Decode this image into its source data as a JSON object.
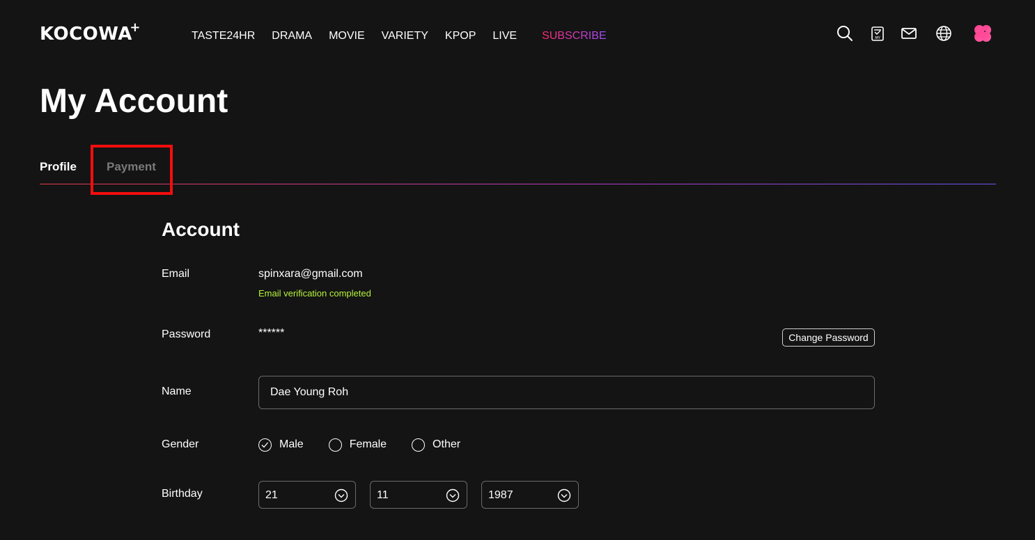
{
  "header": {
    "logo": "KOCOWA",
    "logo_plus": "+",
    "nav": [
      "TASTE24HR",
      "DRAMA",
      "MOVIE",
      "VARIETY",
      "KPOP",
      "LIVE"
    ],
    "subscribe": "SUBSCRIBE",
    "icons": [
      "search-icon",
      "my-list-icon",
      "mail-icon",
      "globe-icon",
      "profile-avatar-icon"
    ],
    "my_list_icon_text": "MY"
  },
  "page": {
    "title": "My Account"
  },
  "tabs": [
    {
      "label": "Profile",
      "active": true
    },
    {
      "label": "Payment",
      "active": false
    }
  ],
  "account": {
    "section_title": "Account",
    "email_label": "Email",
    "email_value": "spinxara@gmail.com",
    "email_note": "Email verification completed",
    "password_label": "Password",
    "password_value": "******",
    "change_password": "Change Password",
    "name_label": "Name",
    "name_value": "Dae Young Roh",
    "gender_label": "Gender",
    "gender_options": [
      {
        "label": "Male",
        "selected": true
      },
      {
        "label": "Female",
        "selected": false
      },
      {
        "label": "Other",
        "selected": false
      }
    ],
    "birthday_label": "Birthday",
    "birthday_day": "21",
    "birthday_month": "11",
    "birthday_year": "1987"
  },
  "colors": {
    "background": "#141414",
    "subscribe_gradient_start": "#ff2a6d",
    "subscribe_gradient_end": "#a24dff",
    "verify_green": "#b6f53a",
    "highlight_red": "#f40d0d"
  }
}
